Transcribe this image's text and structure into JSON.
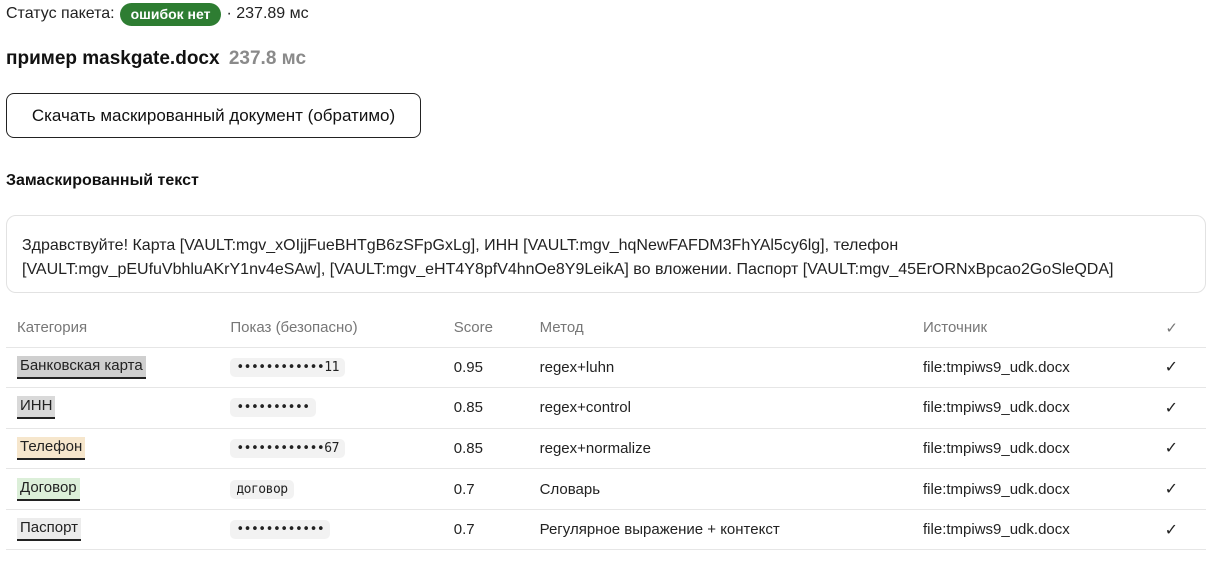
{
  "status": {
    "label": "Статус пакета:",
    "badge": "ошибок нет",
    "time": "· 237.89 мс",
    "badge_color": "#2e7d32"
  },
  "document": {
    "name": "пример maskgate.docx",
    "time": "237.8 мс"
  },
  "download_button": "Скачать маскированный документ (обратимо)",
  "masked_section": {
    "title": "Замаскированный текст",
    "line1": "Здравствуйте! Карта [VAULT:mgv_xOIjjFueBHTgB6zSFpGxLg], ИНН [VAULT:mgv_hqNewFAFDM3FhYAl5cy6lg], телефон",
    "line2": "[VAULT:mgv_pEUfuVbhluAKrY1nv4eSAw], [VAULT:mgv_eHT4Y8pfV4hnOe8Y9LeikA] во вложении. Паспорт [VAULT:mgv_45ErORNxBpcao2GoSleQDA]"
  },
  "table": {
    "headers": [
      "Категория",
      "Показ (безопасно)",
      "Score",
      "Метод",
      "Источник",
      "✓"
    ],
    "rows": [
      {
        "category": "Банковская карта",
        "category_color": "#cfcfcf",
        "show": "••••••••••••11",
        "score": "0.95",
        "method": "regex+luhn",
        "source": "file:tmpiws9_udk.docx",
        "check": "✓"
      },
      {
        "category": "ИНН",
        "category_color": "#d9d9d9",
        "show": "••••••••••",
        "score": "0.85",
        "method": "regex+control",
        "source": "file:tmpiws9_udk.docx",
        "check": "✓"
      },
      {
        "category": "Телефон",
        "category_color": "#f6e6cc",
        "show": "••••••••••••67",
        "score": "0.85",
        "method": "regex+normalize",
        "source": "file:tmpiws9_udk.docx",
        "check": "✓"
      },
      {
        "category": "Договор",
        "category_color": "#dcefd9",
        "show": "договор",
        "score": "0.7",
        "method": "Словарь",
        "source": "file:tmpiws9_udk.docx",
        "check": "✓"
      },
      {
        "category": "Паспорт",
        "category_color": "#ececec",
        "show": "••••••••••••",
        "score": "0.7",
        "method": "Регулярное выражение + контекст",
        "source": "file:tmpiws9_udk.docx",
        "check": "✓"
      }
    ]
  }
}
